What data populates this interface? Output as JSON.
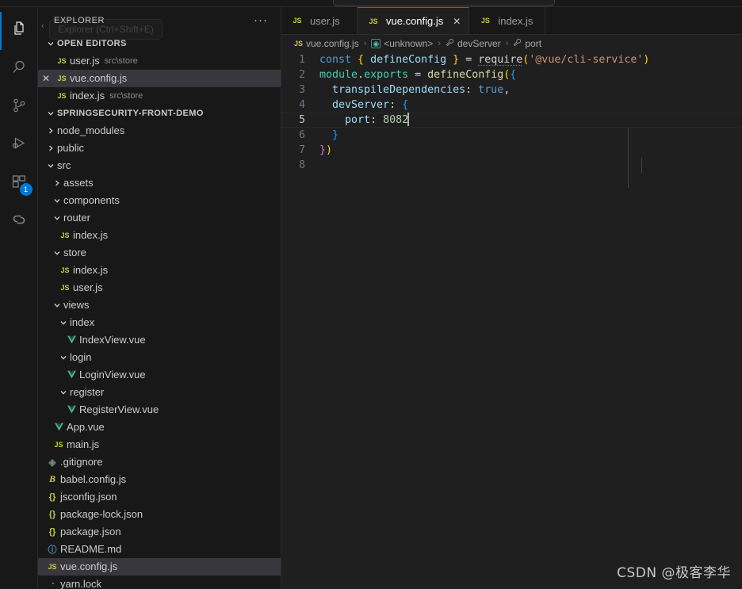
{
  "window": {
    "theme_bg": "#1e1e1e",
    "accent": "#0078d4"
  },
  "activity_bar": {
    "items": [
      {
        "name": "explorer",
        "icon": "files-icon",
        "active": true,
        "badge": ""
      },
      {
        "name": "search",
        "icon": "search-icon",
        "active": false,
        "badge": ""
      },
      {
        "name": "source-control",
        "icon": "source-control-icon",
        "active": false,
        "badge": ""
      },
      {
        "name": "run-and-debug",
        "icon": "run-and-debug-icon",
        "active": false,
        "badge": ""
      },
      {
        "name": "extensions",
        "icon": "extensions-icon",
        "active": false,
        "badge": "1"
      },
      {
        "name": "live-share",
        "icon": "live-share-icon",
        "active": false,
        "badge": ""
      }
    ]
  },
  "sidebar": {
    "title": "EXPLORER",
    "tooltip": "Explorer (Ctrl+Shift+E)",
    "more_actions": "···",
    "collapse_chevron": "‹",
    "open_editors": {
      "label": "OPEN EDITORS",
      "items": [
        {
          "icon": "js-icon",
          "name": "user.js",
          "description": "src\\store",
          "selected": false,
          "has_close": false
        },
        {
          "icon": "js-icon",
          "name": "vue.config.js",
          "description": "",
          "selected": true,
          "has_close": true
        },
        {
          "icon": "js-icon",
          "name": "index.js",
          "description": "src\\store",
          "selected": false,
          "has_close": false
        }
      ]
    },
    "project": {
      "label": "SPRINGSECURITY-FRONT-DEMO",
      "tree": [
        {
          "name": "node_modules",
          "type": "folder",
          "expanded": false,
          "depth": 1
        },
        {
          "name": "public",
          "type": "folder",
          "expanded": false,
          "depth": 1
        },
        {
          "name": "src",
          "type": "folder",
          "expanded": true,
          "depth": 1
        },
        {
          "name": "assets",
          "type": "folder",
          "expanded": false,
          "depth": 2
        },
        {
          "name": "components",
          "type": "folder",
          "expanded": true,
          "depth": 2
        },
        {
          "name": "router",
          "type": "folder",
          "expanded": true,
          "depth": 2
        },
        {
          "name": "index.js",
          "type": "js",
          "depth": 3
        },
        {
          "name": "store",
          "type": "folder",
          "expanded": true,
          "depth": 2
        },
        {
          "name": "index.js",
          "type": "js",
          "depth": 3
        },
        {
          "name": "user.js",
          "type": "js",
          "depth": 3
        },
        {
          "name": "views",
          "type": "folder",
          "expanded": true,
          "depth": 2
        },
        {
          "name": "index",
          "type": "folder",
          "expanded": true,
          "depth": 3
        },
        {
          "name": "IndexView.vue",
          "type": "vue",
          "depth": 4
        },
        {
          "name": "login",
          "type": "folder",
          "expanded": true,
          "depth": 3
        },
        {
          "name": "LoginView.vue",
          "type": "vue",
          "depth": 4
        },
        {
          "name": "register",
          "type": "folder",
          "expanded": true,
          "depth": 3
        },
        {
          "name": "RegisterView.vue",
          "type": "vue",
          "depth": 4
        },
        {
          "name": "App.vue",
          "type": "vue",
          "depth": 2
        },
        {
          "name": "main.js",
          "type": "js",
          "depth": 2
        },
        {
          "name": ".gitignore",
          "type": "git",
          "depth": 1
        },
        {
          "name": "babel.config.js",
          "type": "babel",
          "depth": 1
        },
        {
          "name": "jsconfig.json",
          "type": "json",
          "depth": 1
        },
        {
          "name": "package-lock.json",
          "type": "json",
          "depth": 1
        },
        {
          "name": "package.json",
          "type": "json",
          "depth": 1
        },
        {
          "name": "README.md",
          "type": "md",
          "depth": 1
        },
        {
          "name": "vue.config.js",
          "type": "js",
          "depth": 1,
          "selected": true
        },
        {
          "name": "yarn.lock",
          "type": "yarn",
          "depth": 1
        }
      ]
    }
  },
  "editor": {
    "tabs": [
      {
        "icon": "js-icon",
        "label": "user.js",
        "active": false,
        "dirty": false
      },
      {
        "icon": "js-icon",
        "label": "vue.config.js",
        "active": true,
        "dirty": false,
        "close": "✕"
      },
      {
        "icon": "js-icon",
        "label": "index.js",
        "active": false,
        "dirty": false
      }
    ],
    "breadcrumbs": [
      {
        "icon": "js-icon",
        "label": "vue.config.js"
      },
      {
        "icon": "module-icon",
        "label": "<unknown>"
      },
      {
        "icon": "property-icon",
        "label": "devServer"
      },
      {
        "icon": "property-icon",
        "label": "port"
      }
    ],
    "breadcrumb_separator": "›",
    "language": "javascript",
    "lines": [
      {
        "number": "1",
        "current": false
      },
      {
        "number": "2",
        "current": false
      },
      {
        "number": "3",
        "current": false
      },
      {
        "number": "4",
        "current": false
      },
      {
        "number": "5",
        "current": true
      },
      {
        "number": "6",
        "current": false
      },
      {
        "number": "7",
        "current": false
      },
      {
        "number": "8",
        "current": false
      }
    ],
    "code": {
      "l1": {
        "kw": "const",
        "b1": "{",
        "id": "defineConfig",
        "b2": "}",
        "eq": "=",
        "fn": "require",
        "p1": "(",
        "str": "'@vue/cli-service'",
        "p2": ")"
      },
      "l2": {
        "obj": "module",
        "dot": ".",
        "prop": "exports",
        "eq": "=",
        "fn": "defineConfig",
        "p": "(",
        "brace": "{"
      },
      "l3": {
        "key": "transpileDependencies",
        "colon": ":",
        "val": "true",
        "comma": ","
      },
      "l4": {
        "key": "devServer",
        "colon": ":",
        "brace": "{"
      },
      "l5": {
        "key": "port",
        "colon": ":",
        "val": "8082"
      },
      "l6": {
        "brace": "}"
      },
      "l7": {
        "brace": "}",
        "paren": ")"
      },
      "l8": {
        "text": ""
      }
    }
  },
  "watermark": "CSDN @极客李华"
}
